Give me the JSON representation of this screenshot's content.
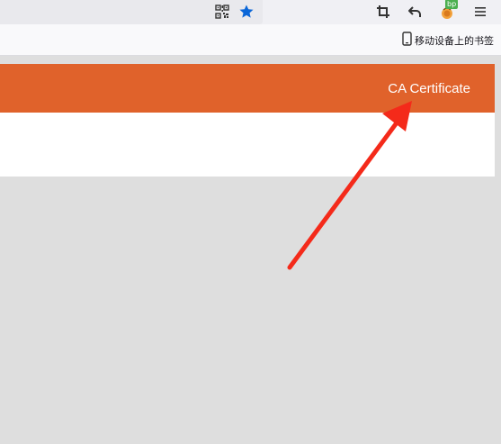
{
  "browser": {
    "bookmarks_bar": {
      "mobile_bookmarks_label": "移动设备上的书签"
    },
    "extension_badge": "bp",
    "icons": [
      "qr-code-icon",
      "bookmark-star-icon",
      "crop-icon",
      "undo-icon",
      "extension-icon",
      "menu-icon",
      "mobile-device-icon"
    ]
  },
  "page": {
    "header_link": "CA Certificate",
    "colors": {
      "header_bg": "#e0622b",
      "arrow": "#f42a1a",
      "star": "#0a66d8",
      "page_bg": "#dedede"
    }
  }
}
